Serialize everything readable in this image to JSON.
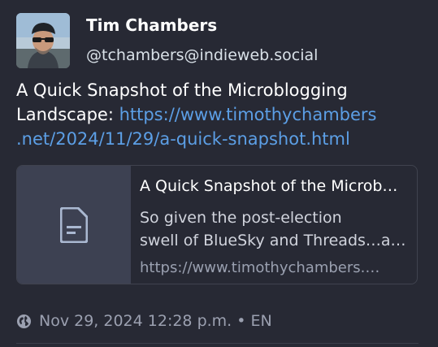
{
  "author": {
    "name": "Tim Chambers",
    "handle": "@tchambers@indieweb.social"
  },
  "post": {
    "text": "A Quick Snapshot of the Microblogging Landscape: ",
    "link_line1": "https://www.timothychambers",
    "link_line2": ".net/2024/11/29/a-quick-snapshot.html"
  },
  "card": {
    "title": "A Quick Snapshot of the Microb…",
    "desc_line1": "So given the post-election",
    "desc_line2": "swell of BlueSky and Threads…a…",
    "url": "https://www.timothychambers.…",
    "thumb_icon": "document-icon"
  },
  "meta": {
    "visibility_icon": "globe-icon",
    "timestamp": "Nov 29, 2024 12:28 p.m.",
    "separator": "•",
    "language": "EN"
  },
  "colors": {
    "background": "#272934",
    "link": "#5c9fe6",
    "card_thumb": "#3d4152",
    "muted": "#9ba0b0"
  }
}
